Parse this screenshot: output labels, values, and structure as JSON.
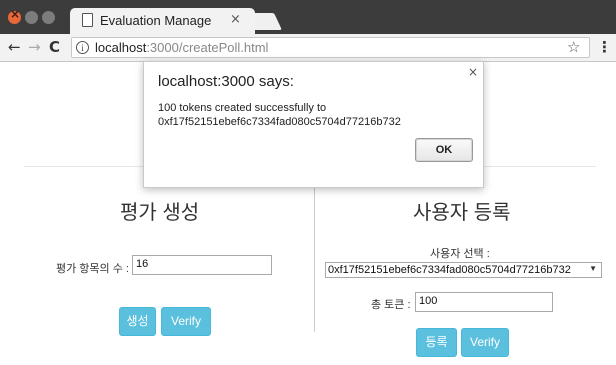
{
  "browser": {
    "tab_title": "Evaluation Manage",
    "tab_close": "×",
    "url_host": "localhost",
    "url_path": ":3000/createPoll.html",
    "icons": [
      "back-arrow-icon",
      "forward-arrow-icon",
      "reload-icon",
      "info-icon",
      "star-icon",
      "menu-icon",
      "page-icon"
    ]
  },
  "dialog": {
    "title": "localhost:3000 says:",
    "close": "×",
    "message_line1": "100 tokens created successfully to",
    "message_line2": "0xf17f52151ebef6c7334fad080c5704d77216b732",
    "ok_label": "OK"
  },
  "left_panel": {
    "heading": "평가 생성",
    "items_label": "평가 항목의 수 :",
    "items_value": "16",
    "create_button": "생성",
    "verify_button": "Verify"
  },
  "right_panel": {
    "heading": "사용자 등록",
    "select_label": "사용자 선택 :",
    "selected_user": "0xf17f52151ebef6c7334fad080c5704d77216b732",
    "total_token_label": "총 토큰 :",
    "total_token_value": "100",
    "register_button": "등록",
    "verify_button": "Verify"
  },
  "colors": {
    "titlebar": "#3c3c3c",
    "button": "#5bc0de",
    "close_button": "#e8683a"
  }
}
